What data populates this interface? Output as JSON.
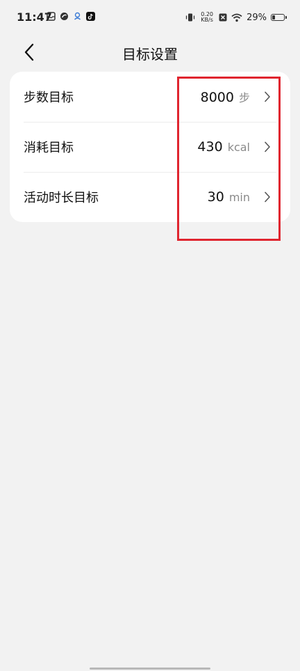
{
  "status_bar": {
    "time": "11:47",
    "net_speed_value": "0.20",
    "net_speed_unit": "KB/s",
    "battery": "29%",
    "battery_level": 0.29
  },
  "header": {
    "title": "目标设置"
  },
  "goals": [
    {
      "label": "步数目标",
      "value": "8000",
      "unit": "步"
    },
    {
      "label": "消耗目标",
      "value": "430",
      "unit": "kcal"
    },
    {
      "label": "活动时长目标",
      "value": "30",
      "unit": "min"
    }
  ],
  "colors": {
    "background": "#f2f2f2",
    "card": "#ffffff",
    "highlight": "#e0252f"
  }
}
